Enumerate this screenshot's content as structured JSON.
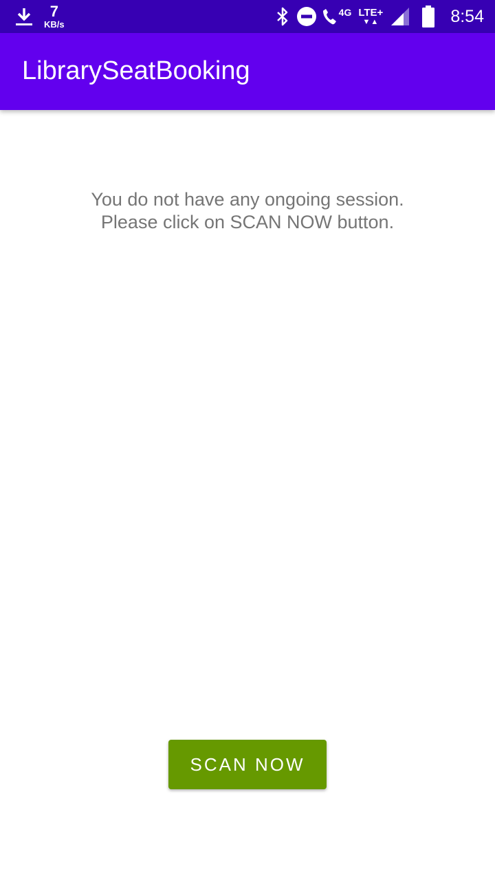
{
  "status_bar": {
    "download_icon": "download-icon",
    "speed_value": "7",
    "speed_unit": "KB/s",
    "bluetooth_icon": "bluetooth-icon",
    "dnd_icon": "do-not-disturb-icon",
    "call_icon": "wifi-calling-icon",
    "call_network": "4G",
    "lte_label": "LTE+",
    "signal_icon": "cell-signal-icon",
    "battery_icon": "battery-icon",
    "time": "8:54"
  },
  "app_bar": {
    "title": "LibrarySeatBooking",
    "color": "#6200ee",
    "status_color": "#3700b3"
  },
  "main": {
    "message_line1": "You do not have any ongoing session.",
    "message_line2": "Please click on SCAN NOW button.",
    "scan_button_label": "SCAN NOW",
    "scan_button_color": "#669900"
  }
}
